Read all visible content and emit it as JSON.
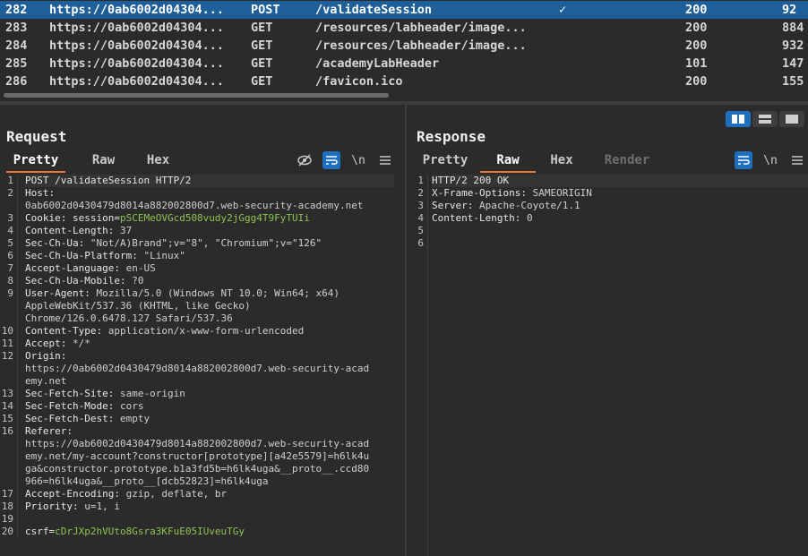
{
  "history": {
    "rows": [
      {
        "num": "282",
        "host": "https://0ab6002d04304...",
        "method": "POST",
        "url": "/validateSession",
        "check": "✓",
        "status": "200",
        "length": "92",
        "selected": true
      },
      {
        "num": "283",
        "host": "https://0ab6002d04304...",
        "method": "GET",
        "url": "/resources/labheader/image...",
        "check": "",
        "status": "200",
        "length": "884"
      },
      {
        "num": "284",
        "host": "https://0ab6002d04304...",
        "method": "GET",
        "url": "/resources/labheader/image...",
        "check": "",
        "status": "200",
        "length": "932"
      },
      {
        "num": "285",
        "host": "https://0ab6002d04304...",
        "method": "GET",
        "url": "/academyLabHeader",
        "check": "",
        "status": "101",
        "length": "147"
      },
      {
        "num": "286",
        "host": "https://0ab6002d04304...",
        "method": "GET",
        "url": "/favicon.ico",
        "check": "",
        "status": "200",
        "length": "155"
      }
    ]
  },
  "request": {
    "title": "Request",
    "tabs": [
      "Pretty",
      "Raw",
      "Hex"
    ],
    "active_tab": "Pretty",
    "tool_newline": "\\n",
    "lines": [
      {
        "n": "1",
        "parts": [
          {
            "t": "POST /validateSession HTTP/2",
            "c": "k"
          }
        ]
      },
      {
        "n": "2",
        "parts": [
          {
            "t": "Host:",
            "c": "k"
          }
        ]
      },
      {
        "n": "",
        "parts": [
          {
            "t": "0ab6002d0430479d8014a882002800d7.web-security-academy.net",
            "c": "v"
          }
        ]
      },
      {
        "n": "3",
        "parts": [
          {
            "t": "Cookie: session=",
            "c": "k"
          },
          {
            "t": "pSCEMeOVGcd508vudy2jGgg4T9FyTUIi",
            "c": "g"
          }
        ]
      },
      {
        "n": "4",
        "parts": [
          {
            "t": "Content-Length: ",
            "c": "k"
          },
          {
            "t": "37",
            "c": "v"
          }
        ]
      },
      {
        "n": "5",
        "parts": [
          {
            "t": "Sec-Ch-Ua: ",
            "c": "k"
          },
          {
            "t": "\"Not/A)Brand\";v=\"8\", \"Chromium\";v=\"126\"",
            "c": "v"
          }
        ]
      },
      {
        "n": "6",
        "parts": [
          {
            "t": "Sec-Ch-Ua-Platform: ",
            "c": "k"
          },
          {
            "t": "\"Linux\"",
            "c": "v"
          }
        ]
      },
      {
        "n": "7",
        "parts": [
          {
            "t": "Accept-Language: ",
            "c": "k"
          },
          {
            "t": "en-US",
            "c": "v"
          }
        ]
      },
      {
        "n": "8",
        "parts": [
          {
            "t": "Sec-Ch-Ua-Mobile: ",
            "c": "k"
          },
          {
            "t": "?0",
            "c": "v"
          }
        ]
      },
      {
        "n": "9",
        "parts": [
          {
            "t": "User-Agent: ",
            "c": "k"
          },
          {
            "t": "Mozilla/5.0 (Windows NT 10.0; Win64; x64)",
            "c": "v"
          }
        ]
      },
      {
        "n": "",
        "parts": [
          {
            "t": "AppleWebKit/537.36 (KHTML, like Gecko)",
            "c": "v"
          }
        ]
      },
      {
        "n": "",
        "parts": [
          {
            "t": "Chrome/126.0.6478.127 Safari/537.36",
            "c": "v"
          }
        ]
      },
      {
        "n": "10",
        "parts": [
          {
            "t": "Content-Type: ",
            "c": "k"
          },
          {
            "t": "application/x-www-form-urlencoded",
            "c": "v"
          }
        ]
      },
      {
        "n": "11",
        "parts": [
          {
            "t": "Accept: ",
            "c": "k"
          },
          {
            "t": "*/*",
            "c": "v"
          }
        ]
      },
      {
        "n": "12",
        "parts": [
          {
            "t": "Origin:",
            "c": "k"
          }
        ]
      },
      {
        "n": "",
        "parts": [
          {
            "t": "https://0ab6002d0430479d8014a882002800d7.web-security-acad",
            "c": "v"
          }
        ]
      },
      {
        "n": "",
        "parts": [
          {
            "t": "emy.net",
            "c": "v"
          }
        ]
      },
      {
        "n": "13",
        "parts": [
          {
            "t": "Sec-Fetch-Site: ",
            "c": "k"
          },
          {
            "t": "same-origin",
            "c": "v"
          }
        ]
      },
      {
        "n": "14",
        "parts": [
          {
            "t": "Sec-Fetch-Mode: ",
            "c": "k"
          },
          {
            "t": "cors",
            "c": "v"
          }
        ]
      },
      {
        "n": "15",
        "parts": [
          {
            "t": "Sec-Fetch-Dest: ",
            "c": "k"
          },
          {
            "t": "empty",
            "c": "v"
          }
        ]
      },
      {
        "n": "16",
        "parts": [
          {
            "t": "Referer:",
            "c": "k"
          }
        ]
      },
      {
        "n": "",
        "parts": [
          {
            "t": "https://0ab6002d0430479d8014a882002800d7.web-security-acad",
            "c": "v"
          }
        ]
      },
      {
        "n": "",
        "parts": [
          {
            "t": "emy.net/my-account?constructor[prototype][a42e5579]=h6lk4u",
            "c": "v"
          }
        ]
      },
      {
        "n": "",
        "parts": [
          {
            "t": "ga&constructor.prototype.b1a3fd5b=h6lk4uga&__proto__.ccd80",
            "c": "v"
          }
        ]
      },
      {
        "n": "",
        "parts": [
          {
            "t": "966=h6lk4uga&__proto__[dcb52823]=h6lk4uga",
            "c": "v"
          }
        ]
      },
      {
        "n": "17",
        "parts": [
          {
            "t": "Accept-Encoding: ",
            "c": "k"
          },
          {
            "t": "gzip, deflate, br",
            "c": "v"
          }
        ]
      },
      {
        "n": "18",
        "parts": [
          {
            "t": "Priority: ",
            "c": "k"
          },
          {
            "t": "u=1, i",
            "c": "v"
          }
        ]
      },
      {
        "n": "19",
        "parts": []
      },
      {
        "n": "20",
        "parts": [
          {
            "t": "csrf=",
            "c": "k"
          },
          {
            "t": "cDrJXp2hVUto8Gsra3KFuE05IUveuTGy",
            "c": "g"
          }
        ]
      }
    ]
  },
  "response": {
    "title": "Response",
    "tabs": [
      "Pretty",
      "Raw",
      "Hex",
      "Render"
    ],
    "active_tab": "Raw",
    "tool_newline": "\\n",
    "lines": [
      {
        "n": "1",
        "parts": [
          {
            "t": "HTTP/2 200 OK",
            "c": "k"
          }
        ]
      },
      {
        "n": "2",
        "parts": [
          {
            "t": "X-Frame-Options: ",
            "c": "k"
          },
          {
            "t": "SAMEORIGIN",
            "c": "v"
          }
        ]
      },
      {
        "n": "3",
        "parts": [
          {
            "t": "Server: ",
            "c": "k"
          },
          {
            "t": "Apache-Coyote/1.1",
            "c": "v"
          }
        ]
      },
      {
        "n": "4",
        "parts": [
          {
            "t": "Content-Length: ",
            "c": "k"
          },
          {
            "t": "0",
            "c": "v"
          }
        ]
      },
      {
        "n": "5",
        "parts": []
      },
      {
        "n": "6",
        "parts": []
      }
    ]
  },
  "colors": {
    "accent": "#1f6fbf",
    "tab_underline": "#e8793a",
    "token_green": "#8fc24f",
    "selected_row": "#1f5f99"
  }
}
